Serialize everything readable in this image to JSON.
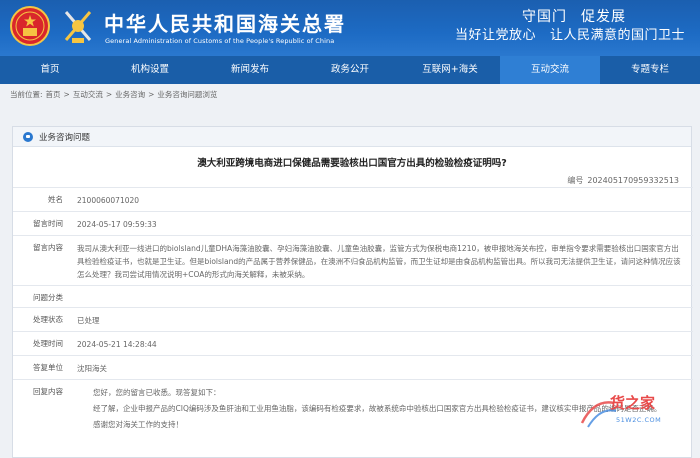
{
  "header": {
    "title_cn": "中华人民共和国海关总署",
    "title_en": "General Administration of Customs of the People's Republic of China",
    "slogan_line1": [
      "守国门",
      "促发展"
    ],
    "slogan_line2": [
      "当好让党放心",
      "让人民满意的国门卫士"
    ]
  },
  "nav": {
    "items": [
      "首页",
      "机构设置",
      "新闻发布",
      "政务公开",
      "互联网+海关",
      "互动交流",
      "专题专栏"
    ],
    "active": "互动交流"
  },
  "breadcrumb": {
    "items": [
      "当前位置:",
      "首页",
      ">",
      "互动交流",
      ">",
      "业务咨询",
      ">",
      "业务咨询问题浏览"
    ]
  },
  "panel": {
    "title": "业务咨询问题",
    "question_title": "澳大利亚跨境电商进口保健品需要验核出口国官方出具的检验检疫证明吗?",
    "number_label": "编号",
    "number_value": "20240517095933​2513",
    "rows": [
      {
        "label": "姓名",
        "value": "2100060071020"
      },
      {
        "label": "留言时间",
        "value": "2024-05-17 09:59:33"
      },
      {
        "label": "留言内容",
        "value": "我司从澳大利亚一线进口的biolsland儿童DHA海藻油胶囊、孕妇海藻油胶囊、儿童鱼油胶囊，监管方式为保税电商1210，被申报地海关布控，审单指令要求需要验核出口国家官方出具检验检疫证书，也就是卫生证。但是biolsland的产品属于营养保健品，在澳洲不归食品机构监管，而卫生证却是由食品机构监管出具。所以我司无法提供卫生证，请问这种情况应该怎么处理？我司尝试用情况说明+COA的形式向海关解释，未被采纳。"
      },
      {
        "label": "问题分类",
        "value": ""
      },
      {
        "label": "处理状态",
        "value": "已处理"
      },
      {
        "label": "处理时间",
        "value": "2024-05-21 14:28:44"
      },
      {
        "label": "答复单位",
        "value": "沈阳海关"
      }
    ],
    "reply_label": "回复内容",
    "reply": [
      "您好，您的留言已收悉。现答复如下：",
      "经了解，企业申报产品的CIQ编码涉及鱼肝油和工业用鱼油脂，该编码有检疫要求，故被系统命中验核出口国家官方出具检验检疫证书，建议核实申报产品的编码是否正确。",
      "感谢您对海关工作的支持！"
    ]
  },
  "watermark": {
    "text": "货之家",
    "sub": "51W2C.COM"
  },
  "colors": {
    "header_blue": "#1d6bc4",
    "nav_blue": "#1a5ea8",
    "nav_active": "#2f7fd4"
  }
}
